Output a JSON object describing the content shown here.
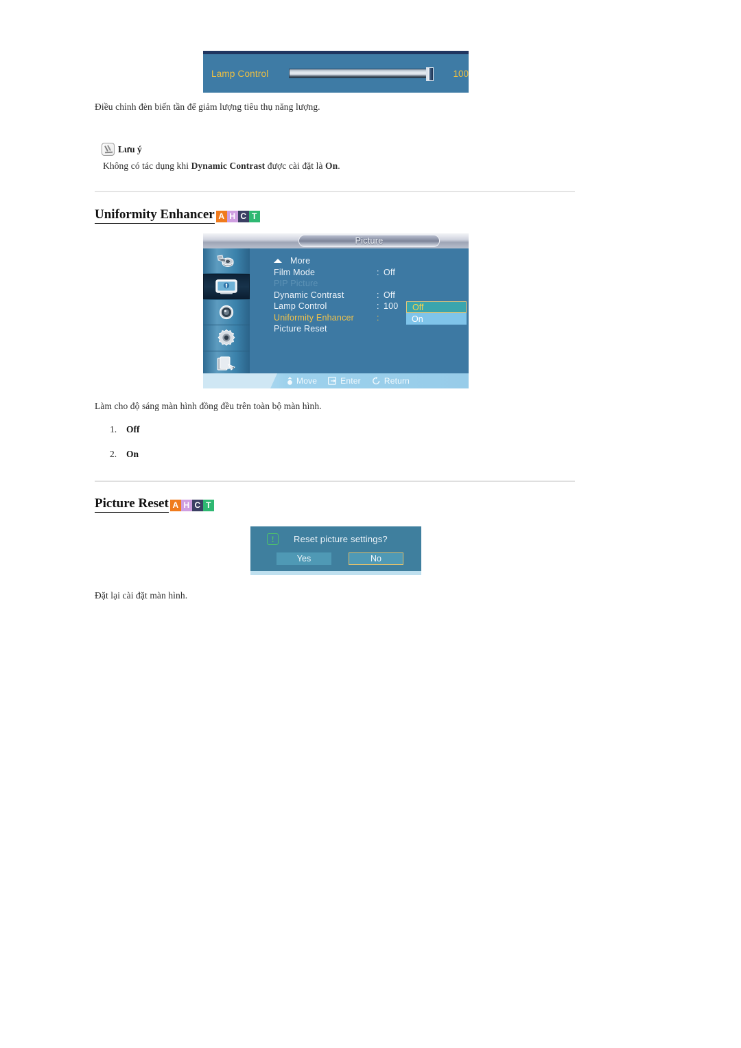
{
  "lamp_widget": {
    "label": "Lamp Control",
    "value": "100",
    "slider_percent": 100
  },
  "paragraphs": {
    "lamp_desc": "Điều chỉnh đèn biến tần để giảm lượng tiêu thụ năng lượng.",
    "uniformity_desc": "Làm cho độ sáng màn hình đồng đều trên toàn bộ màn hình.",
    "reset_desc": "Đặt lại cài đặt màn hình."
  },
  "note": {
    "icon": "note-pencil-icon",
    "title": "Lưu ý",
    "line_before": "Không có tác dụng khi ",
    "bold_term": "Dynamic Contrast",
    "line_middle": " được cài đặt là ",
    "bold_value": "On",
    "line_end": "."
  },
  "headings": {
    "uniformity": "Uniformity Enhancer",
    "picture_reset": "Picture Reset"
  },
  "badges": [
    {
      "letter": "A",
      "color": "#f07b1d"
    },
    {
      "letter": "H",
      "color": "#cf9ee0"
    },
    {
      "letter": "C",
      "color": "#3b3f63"
    },
    {
      "letter": "T",
      "color": "#2eb872"
    }
  ],
  "osd": {
    "title": "Picture",
    "sidebar": [
      {
        "name": "input-source-icon",
        "active": false
      },
      {
        "name": "picture-icon",
        "active": true
      },
      {
        "name": "sound-icon",
        "active": false
      },
      {
        "name": "setup-gear-icon",
        "active": false
      },
      {
        "name": "multi-control-icon",
        "active": false
      }
    ],
    "items": [
      {
        "label": "More",
        "value": "",
        "state": "more"
      },
      {
        "label": "Film Mode",
        "value": "Off",
        "state": "normal"
      },
      {
        "label": "PIP Picture",
        "value": "",
        "state": "dim"
      },
      {
        "label": "Dynamic Contrast",
        "value": "Off",
        "state": "normal"
      },
      {
        "label": "Lamp Control",
        "value": "100",
        "state": "normal"
      },
      {
        "label": "Uniformity Enhancer",
        "value": "",
        "state": "selected"
      },
      {
        "label": "Picture Reset",
        "value": "",
        "state": "normal"
      }
    ],
    "dropdown": {
      "options": [
        "Off",
        "On"
      ],
      "selected": "Off"
    },
    "footer": [
      {
        "icon": "move-joystick-icon",
        "label": "Move"
      },
      {
        "icon": "enter-icon",
        "label": "Enter"
      },
      {
        "icon": "return-icon",
        "label": "Return"
      }
    ]
  },
  "reset_dialog": {
    "icon": "info-exclamation-icon",
    "question": "Reset picture settings?",
    "yes_label": "Yes",
    "no_label": "No",
    "selected": "No"
  },
  "option_list": [
    {
      "num": "1.",
      "text": "Off"
    },
    {
      "num": "2.",
      "text": "On"
    }
  ]
}
